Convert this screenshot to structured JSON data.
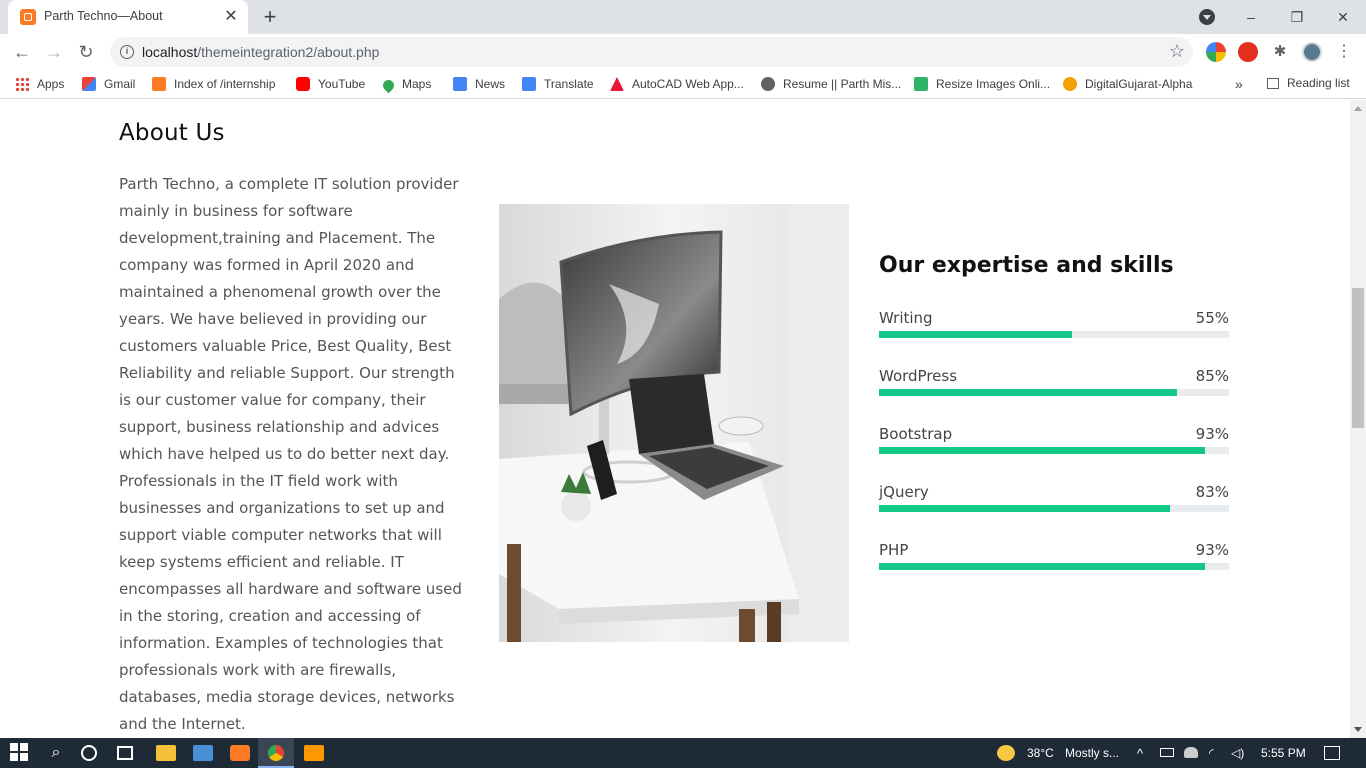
{
  "browser": {
    "tab_title": "Parth Techno—About",
    "new_tab": "+",
    "url_host": "localhost",
    "url_path": "/themeintegration2/about.php",
    "window_controls": [
      "–",
      "❐",
      "✕"
    ]
  },
  "bookmarks": {
    "items": [
      {
        "label": "Apps",
        "icon": "apps-grid-icon"
      },
      {
        "label": "Gmail",
        "icon": "gmail-icon"
      },
      {
        "label": "Index of /internship",
        "icon": "xampp-icon"
      },
      {
        "label": "YouTube",
        "icon": "youtube-icon"
      },
      {
        "label": "Maps",
        "icon": "maps-icon"
      },
      {
        "label": "News",
        "icon": "news-icon"
      },
      {
        "label": "Translate",
        "icon": "translate-icon"
      },
      {
        "label": "AutoCAD Web App...",
        "icon": "autocad-icon"
      },
      {
        "label": "Resume || Parth Mis...",
        "icon": "globe-icon"
      },
      {
        "label": "Resize Images Onli...",
        "icon": "resize-icon"
      },
      {
        "label": "DigitalGujarat-Alpha",
        "icon": "gujarat-icon"
      }
    ],
    "overflow": "»",
    "reading_list": "Reading list"
  },
  "page": {
    "heading": "About Us",
    "body": "Parth Techno, a complete IT solution provider mainly in business for software development,training and Placement. The company was formed in April 2020 and maintained a phenomenal growth over the years. We have believed in providing our customers valuable Price, Best Quality, Best Reliability and reliable Support. Our strength is our customer value for company, their support, business relationship and advices which have helped us to do better next day. Professionals in the IT field work with businesses and organizations to set up and support viable computer networks that will keep systems efficient and reliable. IT encompasses all hardware and software used in the storing, creation and accessing of information. Examples of technologies that professionals work with are firewalls, databases, media storage devices, networks and the Internet.",
    "skills_title": "Our expertise and skills",
    "skills": [
      {
        "name": "Writing",
        "percent_label": "55%",
        "value": 55
      },
      {
        "name": "WordPress",
        "percent_label": "85%",
        "value": 85
      },
      {
        "name": "Bootstrap",
        "percent_label": "93%",
        "value": 93
      },
      {
        "name": "jQuery",
        "percent_label": "83%",
        "value": 83
      },
      {
        "name": "PHP",
        "percent_label": "93%",
        "value": 93
      }
    ],
    "accent_color": "#12c987"
  },
  "taskbar": {
    "weather": "38°C",
    "weather_desc": "Mostly s...",
    "time": "5:55 PM"
  }
}
